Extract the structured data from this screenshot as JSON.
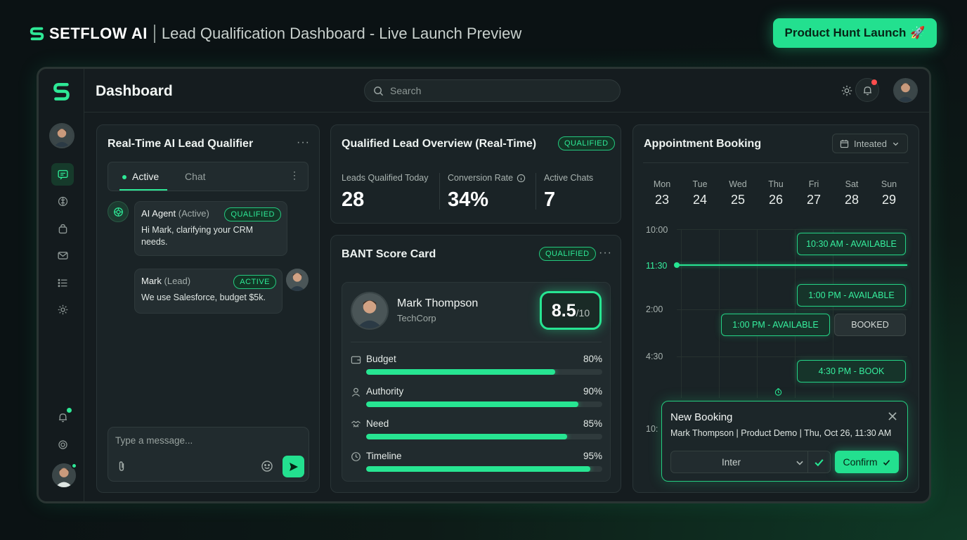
{
  "banner": {
    "brand": "SETFLOW AI",
    "title": "Lead Qualification Dashboard - Live Launch Preview",
    "cta_label": "Product Hunt Launch",
    "cta_emoji": "🚀"
  },
  "header": {
    "title": "Dashboard",
    "search_placeholder": "Search"
  },
  "colors": {
    "accent": "#23e08f",
    "background": "#0b1214",
    "panel": "#1a2326",
    "alert": "#ff4d4d"
  },
  "sidebar": {
    "items": [
      {
        "icon": "chat-icon",
        "active": true
      },
      {
        "icon": "brain-icon",
        "active": false
      },
      {
        "icon": "bag-icon",
        "active": false
      },
      {
        "icon": "mail-icon",
        "active": false
      },
      {
        "icon": "list-icon",
        "active": false
      },
      {
        "icon": "gear-icon",
        "active": false
      }
    ]
  },
  "qualifier": {
    "title": "Real-Time AI Lead Qualifier",
    "tabs": [
      {
        "label": "Active",
        "active": true
      },
      {
        "label": "Chat",
        "active": false
      }
    ],
    "messages": [
      {
        "name": "AI Agent",
        "role": "(Active)",
        "badge": "QUALIFIED",
        "text": "Hi Mark, clarifying your CRM needs."
      },
      {
        "name": "Mark",
        "role": "(Lead)",
        "badge": "ACTIVE",
        "text": "We use Salesforce, budget $5k."
      }
    ],
    "composer_placeholder": "Type a message..."
  },
  "overview": {
    "title": "Qualified Lead Overview (Real-Time)",
    "badge": "QUALIFIED",
    "stats": [
      {
        "label": "Leads Qualified Today",
        "value": "28"
      },
      {
        "label": "Conversion Rate",
        "value": "34%"
      },
      {
        "label": "Active Chats",
        "value": "7"
      }
    ]
  },
  "bant": {
    "title": "BANT Score Card",
    "badge": "QUALIFIED",
    "name": "Mark Thompson",
    "company": "TechCorp",
    "score": "8.5",
    "score_max": "/10",
    "metrics": [
      {
        "label": "Budget",
        "percent_label": "80%",
        "fraction": 0.8,
        "icon": "wallet-icon"
      },
      {
        "label": "Authority",
        "percent_label": "90%",
        "fraction": 0.9,
        "icon": "user-icon"
      },
      {
        "label": "Need",
        "percent_label": "85%",
        "fraction": 0.85,
        "icon": "handshake-icon"
      },
      {
        "label": "Timeline",
        "percent_label": "95%",
        "fraction": 0.95,
        "icon": "clock-icon"
      }
    ]
  },
  "booking": {
    "title": "Appointment Booking",
    "filter_value": "Inteated",
    "days": [
      {
        "name": "Mon",
        "date": "23"
      },
      {
        "name": "Tue",
        "date": "24"
      },
      {
        "name": "Wed",
        "date": "25"
      },
      {
        "name": "Thu",
        "date": "26"
      },
      {
        "name": "Fri",
        "date": "27"
      },
      {
        "name": "Sat",
        "date": "28"
      },
      {
        "name": "Sun",
        "date": "29"
      }
    ],
    "times": [
      "10:00",
      "11:30",
      "2:00",
      "4:30",
      "10:"
    ],
    "slots": [
      {
        "label": "10:30 AM - AVAILABLE",
        "status": "available"
      },
      {
        "label": "1:00 PM - AVAILABLE",
        "status": "available"
      },
      {
        "label": "1:00 PM - AVAILABLE",
        "status": "available"
      },
      {
        "label": "BOOKED",
        "status": "booked"
      },
      {
        "label": "4:30 PM - BOOK",
        "status": "available"
      }
    ],
    "new_booking": {
      "title": "New Booking",
      "details": "Mark Thompson | Product Demo | Thu, Oct 26, 11:30 AM",
      "select_value": "Inter",
      "confirm_label": "Confirm"
    }
  }
}
